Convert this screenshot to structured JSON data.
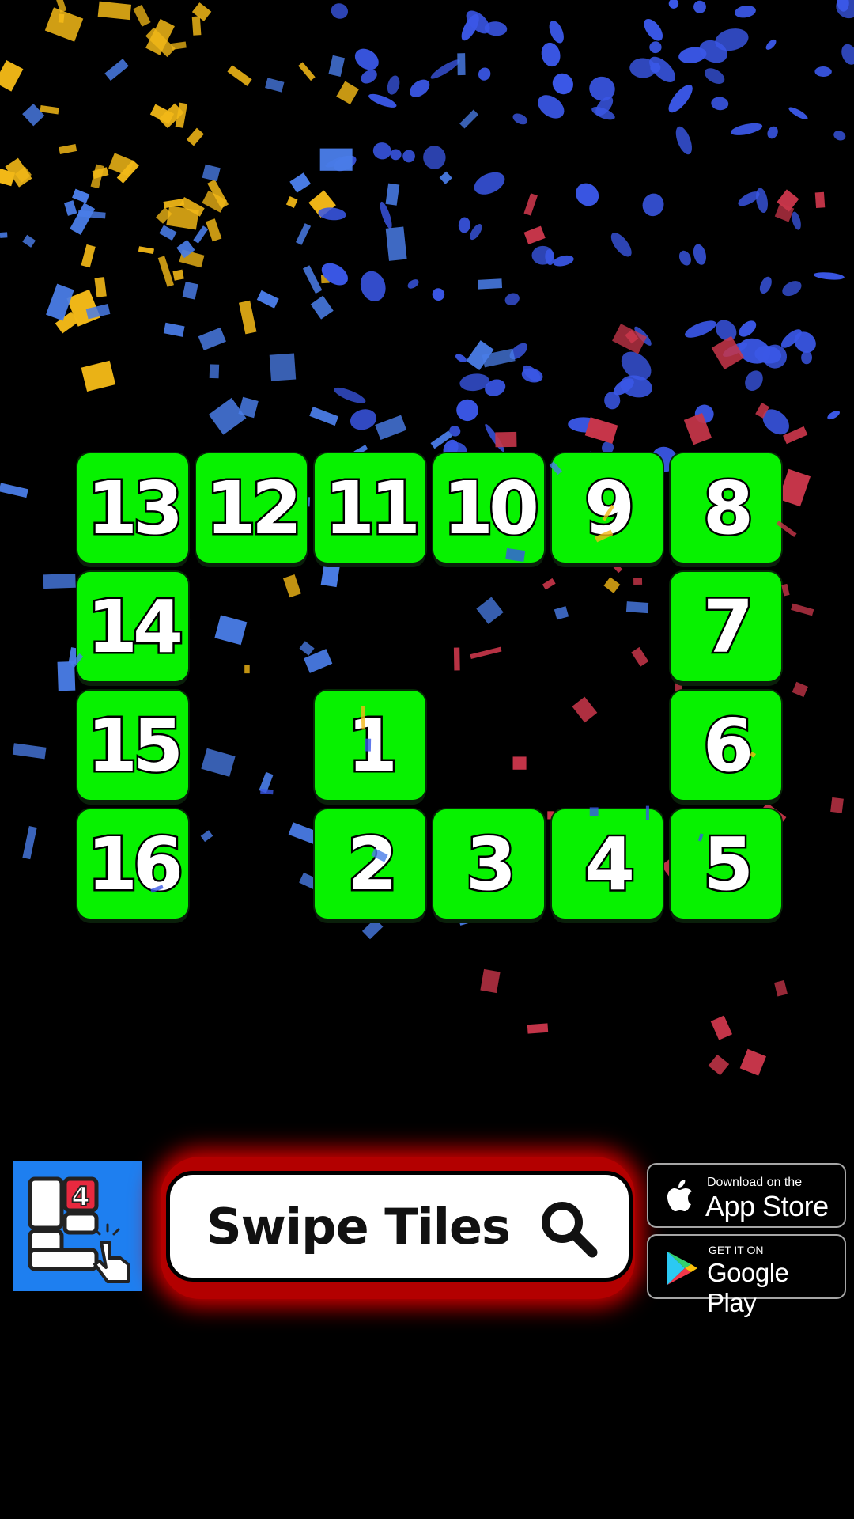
{
  "board": {
    "tiles": [
      {
        "label": "13"
      },
      {
        "label": "12"
      },
      {
        "label": "11"
      },
      {
        "label": "10"
      },
      {
        "label": "9"
      },
      {
        "label": "8"
      },
      {
        "label": "14"
      },
      {
        "label": "7"
      },
      {
        "label": "15"
      },
      {
        "label": "1"
      },
      {
        "label": "6"
      },
      {
        "label": "16"
      },
      {
        "label": "2"
      },
      {
        "label": "3"
      },
      {
        "label": "4"
      },
      {
        "label": "5"
      }
    ],
    "tile_color": "#07f200"
  },
  "promo": {
    "app_icon_badge": "4",
    "search_label": "Swipe Tiles",
    "search_highlight_color": "#d00000",
    "apple_badge": {
      "small": "Download on the",
      "big": "App Store"
    },
    "google_badge": {
      "small": "GET IT ON",
      "big": "Google Play"
    }
  },
  "confetti": {
    "colors": [
      "#f2b817",
      "#3a57e6",
      "#4a7de8",
      "#c8364a"
    ]
  }
}
